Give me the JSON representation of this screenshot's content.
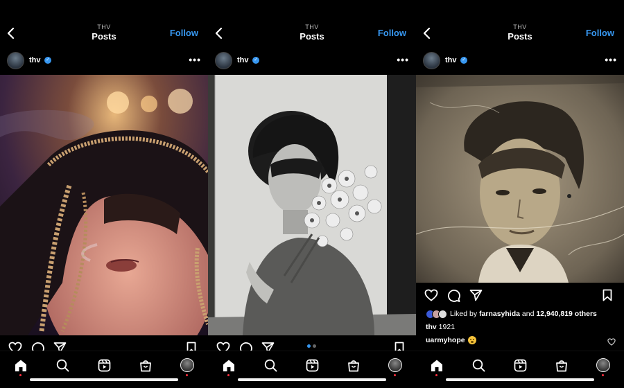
{
  "header": {
    "subtitle": "THV",
    "title": "Posts",
    "follow_label": "Follow"
  },
  "post": {
    "username": "thv",
    "verified_mark": "✓"
  },
  "panel3": {
    "likes_prefix": "Liked by ",
    "liked_by_user": "farnasyhida",
    "likes_and": " and ",
    "likes_count": "12,940,819 others",
    "caption_user": "thv",
    "caption_text": "1921",
    "comment_user": "uarmyhope",
    "comment_emoji": "astonished-face-emoji"
  },
  "carousel": {
    "total_slides": 2,
    "active_slide": 1
  },
  "icons": {
    "back": "chevron-left-icon",
    "more": "more-options-icon",
    "like": "heart-icon",
    "comment": "comment-icon",
    "share": "send-icon",
    "save": "bookmark-icon",
    "nav": [
      "home-icon",
      "search-icon",
      "reels-icon",
      "shop-icon",
      "profile-avatar"
    ]
  },
  "colors": {
    "background": "#000000",
    "accent": "#3797f0",
    "notification": "#ff3040",
    "text": "#ffffff"
  }
}
